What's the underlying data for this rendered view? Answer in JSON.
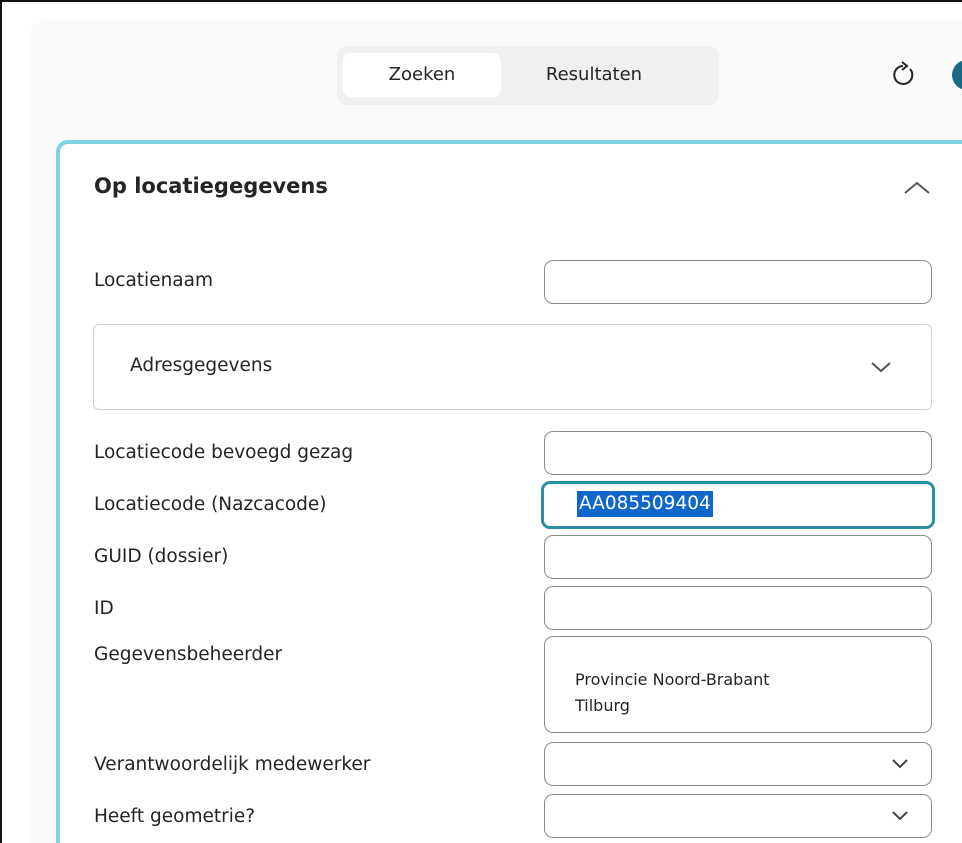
{
  "tabs": [
    {
      "label": "Zoeken",
      "active": true
    },
    {
      "label": "Resultaten",
      "active": false
    }
  ],
  "icons": {
    "refresh": "refresh-icon",
    "help": "help-icon"
  },
  "section": {
    "title": "Op locatiegegevens",
    "fields": {
      "locatienaam": {
        "label": "Locatienaam",
        "value": ""
      },
      "adresgegevens": {
        "label": "Adresgegevens"
      },
      "locatiecode_bg": {
        "label": "Locatiecode bevoegd gezag",
        "value": ""
      },
      "nazcacode": {
        "label": "Locatiecode (Nazcacode)",
        "value": "AA085509404"
      },
      "guid": {
        "label": "GUID (dossier)",
        "value": ""
      },
      "id": {
        "label": "ID",
        "value": ""
      },
      "beheerder": {
        "label": "Gegevensbeheerder",
        "lines": [
          "Provincie Noord-Brabant",
          "Tilburg"
        ]
      },
      "medewerker": {
        "label": "Verantwoordelijk medewerker",
        "value": ""
      },
      "geometrie": {
        "label": "Heeft geometrie?",
        "value": ""
      }
    }
  },
  "colors": {
    "accent": "#7fd3df",
    "focus": "#2a8fa3",
    "selection": "#0f67c9"
  }
}
